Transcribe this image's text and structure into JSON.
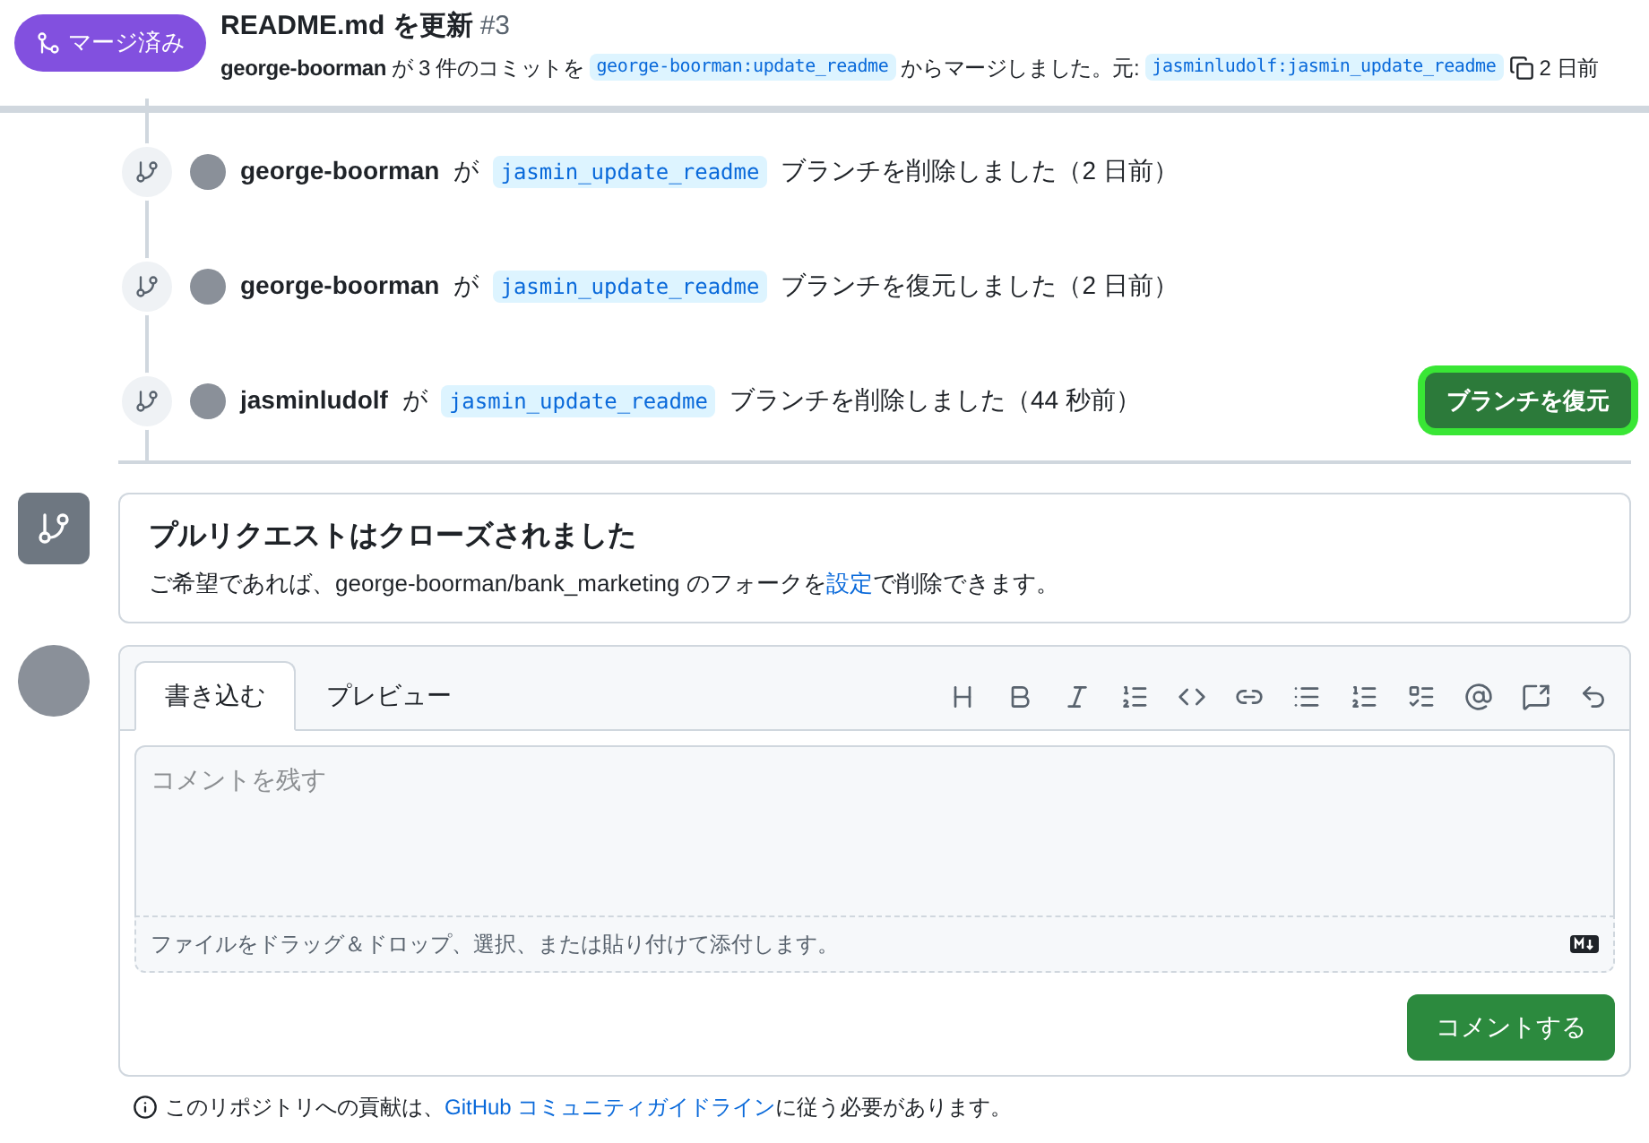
{
  "header": {
    "badge": "マージ済み",
    "title": "README.md を更新",
    "number": "#3",
    "author": "george-boorman",
    "text_before": "が 3 件のコミットを",
    "head_branch": "george-boorman:update_readme",
    "text_middle": "からマージしました。元:",
    "base_branch": "jasminludolf:jasmin_update_readme",
    "time": "2 日前"
  },
  "events": [
    {
      "user": "george-boorman",
      "particle": "が",
      "branch": "jasmin_update_readme",
      "text": "ブランチを削除しました（2 日前）"
    },
    {
      "user": "george-boorman",
      "particle": "が",
      "branch": "jasmin_update_readme",
      "text": "ブランチを復元しました（2 日前）"
    },
    {
      "user": "jasminludolf",
      "particle": "が",
      "branch": "jasmin_update_readme",
      "text": "ブランチを削除しました（44 秒前）",
      "button": "ブランチを復元",
      "highlighted": true
    }
  ],
  "closed": {
    "title": "プルリクエストはクローズされました",
    "before": "ご希望であれば、george-boorman/bank_marketing のフォークを",
    "link": "設定",
    "after": "で削除できます。"
  },
  "editor": {
    "tabs": [
      {
        "label": "書き込む",
        "selected": true
      },
      {
        "label": "プレビュー",
        "selected": false
      }
    ],
    "placeholder": "コメントを残す",
    "attach": "ファイルをドラッグ＆ドロップ、選択、または貼り付けて添付します。",
    "submit": "コメントする"
  },
  "footer": {
    "before": "このリポジトリへの貢献は、",
    "link": "GitHub コミュニティガイドライン",
    "after": "に従う必要があります。"
  }
}
